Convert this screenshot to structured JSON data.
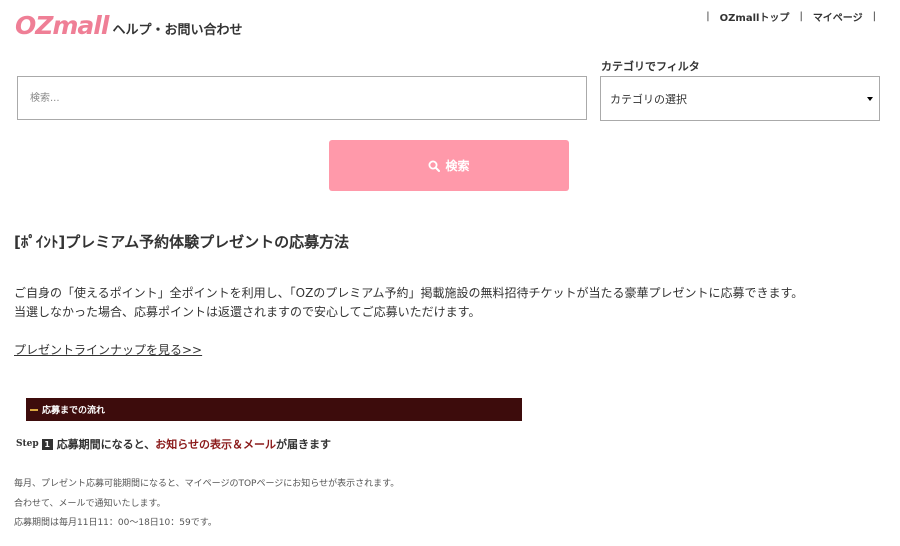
{
  "header": {
    "logo": "OZmall",
    "subtitle": "ヘルプ・お問い合わせ",
    "links": [
      "OZmallトップ",
      "マイページ"
    ]
  },
  "search": {
    "placeholder": "検索...",
    "filter_label": "カテゴリでフィルタ",
    "category_selected": "カテゴリの選択",
    "button_label": "検索"
  },
  "article": {
    "title": "[ﾎﾟｲﾝﾄ]プレミアム予約体験プレゼントの応募方法",
    "paragraph": [
      "ご自身の「使えるポイント」全ポイントを利用し、「OZのプレミアム予約」掲載施設の無料招待チケットが当たる豪華プレゼントに応募できます。",
      "当選しなかった場合、応募ポイントは返還されますので安心してご応募いただけます。"
    ],
    "lineup_link": "プレゼントラインナップを見る>>",
    "flow_heading": "応募までの流れ",
    "step": {
      "word": "Step",
      "number": "1",
      "text_before": "応募期間になると、",
      "highlight": "お知らせの表示＆メール",
      "text_after": "が届きます"
    },
    "notes": [
      "毎月、プレゼント応募可能期間になると、マイページのTOPページにお知らせが表示されます。",
      "合わせて、メールで通知いたします。",
      "応募期間は毎月11日11：00〜18日10：59です。"
    ]
  },
  "colors": {
    "brand_pink": "#ef7f96",
    "button_pink": "#ff99aa",
    "flow_bar": "#3d0c0c",
    "highlight_red": "#8b1a1a"
  }
}
